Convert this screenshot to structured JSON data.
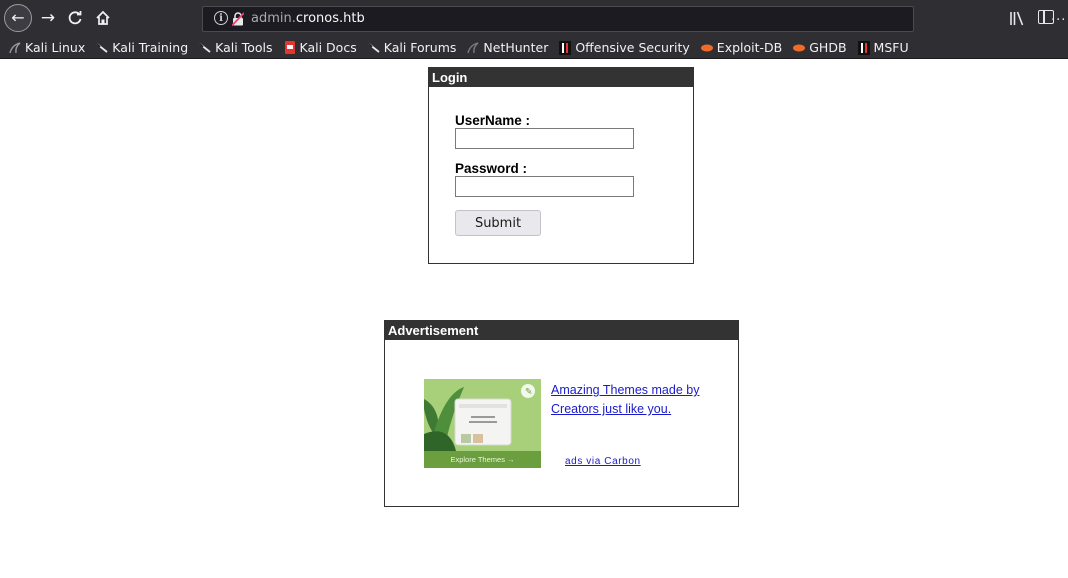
{
  "browser": {
    "url_subdomain": "admin.",
    "url_domain": "cronos.htb",
    "url_more": "···",
    "bookmarks": [
      {
        "label": "Kali Linux",
        "icon": "kali-dragon-icon"
      },
      {
        "label": "Kali Training",
        "icon": "kali-dragon-icon"
      },
      {
        "label": "Kali Tools",
        "icon": "kali-dragon-icon"
      },
      {
        "label": "Kali Docs",
        "icon": "kali-docs-icon"
      },
      {
        "label": "Kali Forums",
        "icon": "kali-dragon-icon"
      },
      {
        "label": "NetHunter",
        "icon": "nethunter-icon"
      },
      {
        "label": "Offensive Security",
        "icon": "offsec-icon"
      },
      {
        "label": "Exploit-DB",
        "icon": "exploitdb-icon"
      },
      {
        "label": "GHDB",
        "icon": "exploitdb-icon"
      },
      {
        "label": "MSFU",
        "icon": "offsec-icon"
      }
    ]
  },
  "login": {
    "header": "Login",
    "username_label": "UserName :",
    "password_label": "Password :",
    "username_value": "",
    "password_value": "",
    "submit_label": "Submit"
  },
  "ad": {
    "header": "Advertisement",
    "link_text": "Amazing Themes made by Creators just like you.",
    "carbon_text": "ads via Carbon",
    "image_caption": "Explore Themes →"
  },
  "colors": {
    "box_header_bg": "#333333",
    "link": "#1a1acc",
    "chrome_bg": "#2f2f33"
  }
}
